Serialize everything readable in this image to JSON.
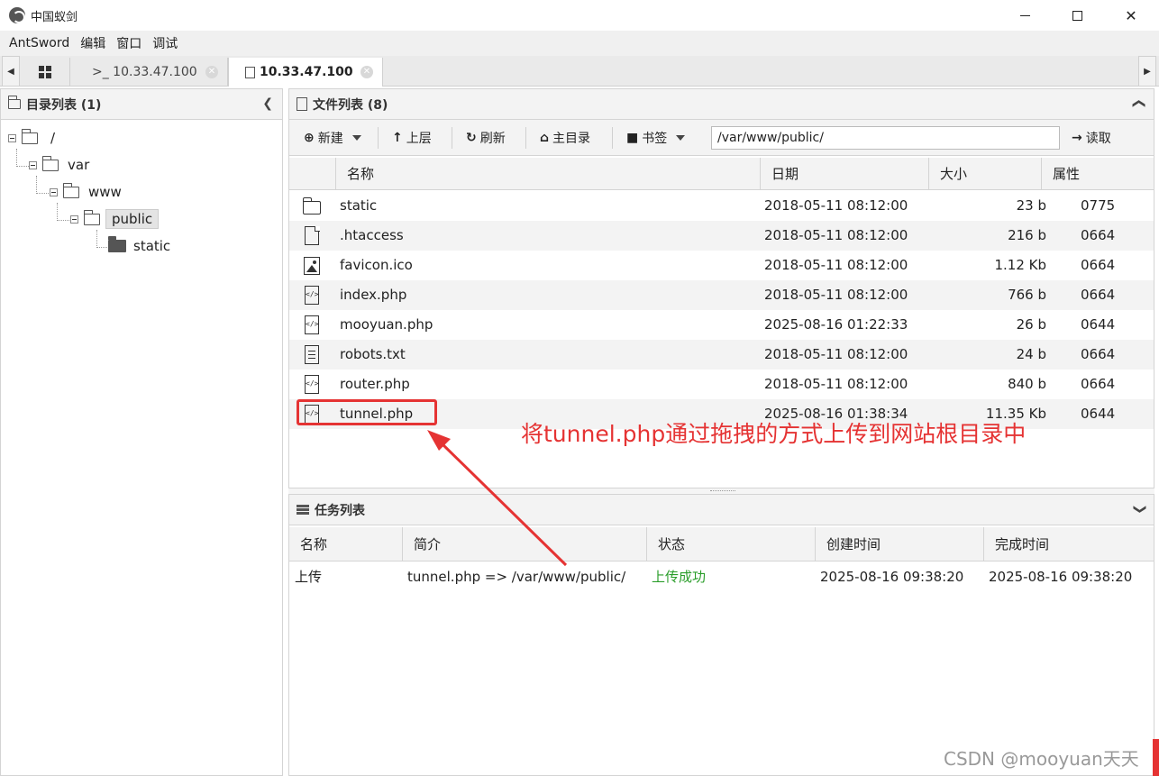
{
  "window": {
    "title": "中国蚁剑"
  },
  "menu": [
    "AntSword",
    "编辑",
    "窗口",
    "调试"
  ],
  "tabs": {
    "terminal_label": ">_ 10.33.47.100",
    "file_label": "10.33.47.100"
  },
  "dir_panel": {
    "title": "目录列表 (1)",
    "tree": [
      {
        "label": "/"
      },
      {
        "label": "var"
      },
      {
        "label": "www"
      },
      {
        "label": "public"
      },
      {
        "label": "static"
      }
    ]
  },
  "file_panel": {
    "title": "文件列表 (8)",
    "toolbar": {
      "new_label": "新建",
      "up_label": "上层",
      "refresh_label": "刷新",
      "home_label": "主目录",
      "bookmark_label": "书签",
      "path_value": "/var/www/public/",
      "read_label": "读取"
    },
    "columns": [
      "名称",
      "日期",
      "大小",
      "属性"
    ],
    "rows": [
      {
        "icon": "folder-icon",
        "name": "static",
        "date": "2018-05-11 08:12:00",
        "size": "23 b",
        "attr": "0775"
      },
      {
        "icon": "file-icon",
        "name": ".htaccess",
        "date": "2018-05-11 08:12:00",
        "size": "216 b",
        "attr": "0664"
      },
      {
        "icon": "image-file-icon",
        "name": "favicon.ico",
        "date": "2018-05-11 08:12:00",
        "size": "1.12 Kb",
        "attr": "0664"
      },
      {
        "icon": "code-file-icon",
        "name": "index.php",
        "date": "2018-05-11 08:12:00",
        "size": "766 b",
        "attr": "0664"
      },
      {
        "icon": "code-file-icon",
        "name": "mooyuan.php",
        "date": "2025-08-16 01:22:33",
        "size": "26 b",
        "attr": "0644"
      },
      {
        "icon": "text-file-icon",
        "name": "robots.txt",
        "date": "2018-05-11 08:12:00",
        "size": "24 b",
        "attr": "0664"
      },
      {
        "icon": "code-file-icon",
        "name": "router.php",
        "date": "2018-05-11 08:12:00",
        "size": "840 b",
        "attr": "0664"
      },
      {
        "icon": "code-file-icon",
        "name": "tunnel.php",
        "date": "2025-08-16 01:38:34",
        "size": "11.35 Kb",
        "attr": "0644"
      }
    ]
  },
  "annotation": {
    "text": "将tunnel.php通过拖拽的方式上传到网站根目录中",
    "color": "#e53333"
  },
  "task_panel": {
    "title": "任务列表",
    "columns": [
      "名称",
      "简介",
      "状态",
      "创建时间",
      "完成时间"
    ],
    "rows": [
      {
        "name": "上传",
        "desc": "tunnel.php => /var/www/public/",
        "status": "上传成功",
        "created": "2025-08-16 09:38:20",
        "finished": "2025-08-16 09:38:20"
      }
    ]
  },
  "watermark": "CSDN @mooyuan天天"
}
